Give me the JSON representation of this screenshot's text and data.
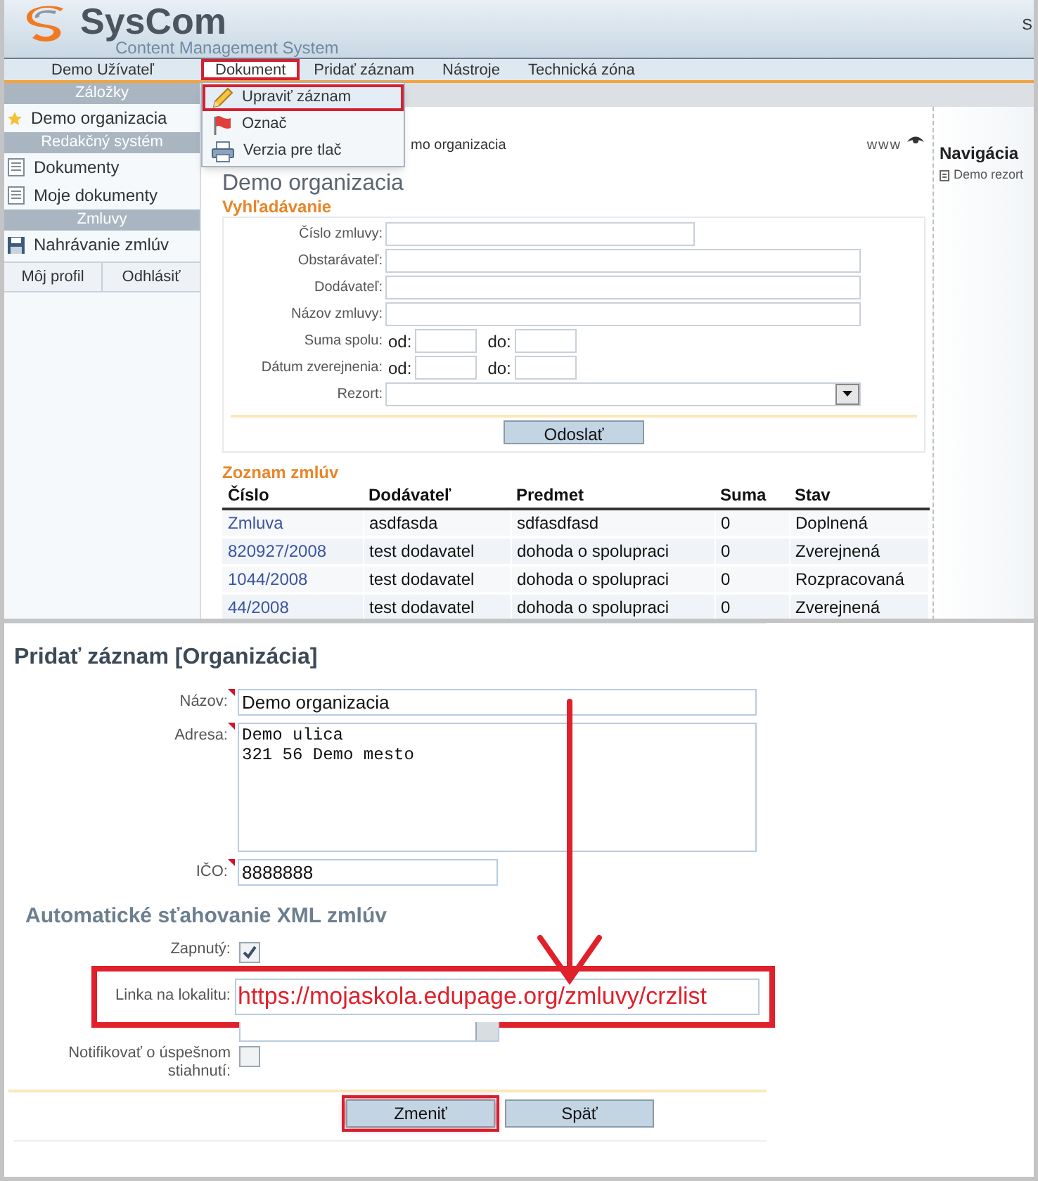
{
  "header": {
    "logo_title": "SysCom",
    "logo_subtitle": "Content Management System",
    "corner_text": "S"
  },
  "menu": {
    "user": "Demo Užívateľ",
    "items": [
      {
        "label": "Dokument",
        "selected": true,
        "highlighted": true
      },
      {
        "label": "Pridať záznam",
        "selected": false,
        "highlighted": false
      },
      {
        "label": "Nástroje",
        "selected": false,
        "highlighted": false
      },
      {
        "label": "Technická zóna",
        "selected": false,
        "highlighted": false
      }
    ]
  },
  "dropdown": {
    "items": [
      {
        "label": "Upraviť záznam",
        "kind": "pencil",
        "highlighted": true
      },
      {
        "label": "Označ",
        "kind": "flag",
        "highlighted": false
      },
      {
        "label": "Verzia pre tlač",
        "kind": "printer",
        "highlighted": false
      }
    ]
  },
  "sidebar": {
    "sections": [
      {
        "title": "Záložky",
        "items": [
          {
            "label": "Demo organizacia",
            "kind": "star"
          }
        ]
      },
      {
        "title": "Redakčný systém",
        "items": [
          {
            "label": "Dokumenty",
            "kind": "document"
          },
          {
            "label": "Moje dokumenty",
            "kind": "document"
          }
        ]
      },
      {
        "title": "Zmluvy",
        "items": [
          {
            "label": "Nahrávanie zmlúv",
            "kind": "floppy"
          }
        ]
      }
    ],
    "footer": [
      "Môj profil",
      "Odhlásiť"
    ]
  },
  "content": {
    "breadcrumb": "mo organizacia",
    "www": "www",
    "heading": "Demo organizacia",
    "search": {
      "title": "Vyhľadávanie",
      "fields": [
        {
          "label": "Číslo zmluvy:",
          "kind": "short"
        },
        {
          "label": "Obstarávateľ:",
          "kind": "wide"
        },
        {
          "label": "Dodávateľ:",
          "kind": "wide"
        },
        {
          "label": "Názov zmluvy:",
          "kind": "wide"
        },
        {
          "label": "Suma spolu:",
          "kind": "range",
          "from": "od:",
          "to": "do:"
        },
        {
          "label": "Dátum zverejnenia:",
          "kind": "range",
          "from": "od:",
          "to": "do:"
        },
        {
          "label": "Rezort:",
          "kind": "select"
        }
      ],
      "button": "Odoslať"
    },
    "list": {
      "title": "Zoznam zmlúv",
      "columns": [
        "Číslo",
        "Dodávateľ",
        "Predmet",
        "Suma",
        "Stav"
      ],
      "rows": [
        [
          "Zmluva",
          "asdfasda",
          "sdfasdfasd",
          "0",
          "Doplnená"
        ],
        [
          "820927/2008",
          "test dodavatel",
          "dohoda o spolupraci",
          "0",
          "Zverejnená"
        ],
        [
          "1044/2008",
          "test dodavatel",
          "dohoda o spolupraci",
          "0",
          "Rozpracovaná"
        ],
        [
          "44/2008",
          "test dodavatel",
          "dohoda o spolupraci",
          "0",
          "Zverejnená"
        ]
      ]
    }
  },
  "navigation": {
    "title": "Navigácia",
    "items": [
      "Demo rezort"
    ]
  },
  "form": {
    "title": "Pridať záznam [Organizácia]",
    "fields": [
      {
        "label": "Názov:",
        "kind": "text",
        "value": "Demo organizacia",
        "required": true
      },
      {
        "label": "Adresa:",
        "kind": "textarea",
        "value": "Demo ulica\n321 56 Demo mesto",
        "required": true
      },
      {
        "label": "IČO:",
        "kind": "short",
        "value": "8888888",
        "required": true
      }
    ],
    "section": "Automatické sťahovanie XML zmlúv",
    "options": [
      {
        "label": "Zapnutý:",
        "kind": "checkbox",
        "checked": true
      },
      {
        "label": "Linka na lokalitu:",
        "kind": "url",
        "value": "https://mojaskola.edupage.org/zmluvy/crzlist",
        "highlighted": true
      },
      {
        "kind": "select"
      },
      {
        "label": "Notifikovať o úspešnom stiahnutí:",
        "kind": "checkbox",
        "checked": false
      }
    ],
    "buttons": [
      {
        "label": "Zmeniť",
        "highlighted": true
      },
      {
        "label": "Späť",
        "highlighted": false
      }
    ]
  }
}
